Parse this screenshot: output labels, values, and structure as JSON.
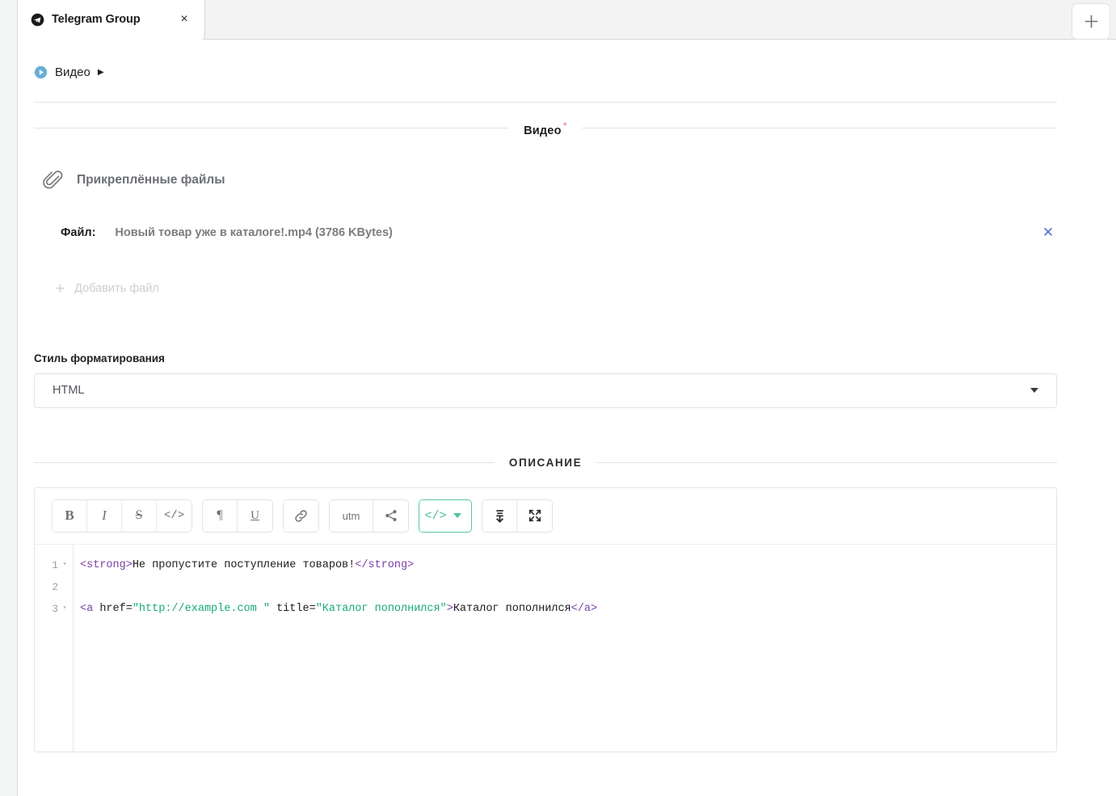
{
  "tab": {
    "title": "Telegram Group",
    "icon": "telegram-icon",
    "close_label": "×",
    "new_tab_label": "+"
  },
  "breadcrumb": {
    "label": "Видео",
    "arrow": "▶"
  },
  "sections": {
    "video": {
      "caption": "Видео",
      "required_mark": "*"
    },
    "description": {
      "caption": "ОПИСАНИЕ"
    }
  },
  "attachments": {
    "title": "Прикреплённые файлы",
    "file_label": "Файл:",
    "file_name": "Новый товар уже в каталоге!.mp4 (3786 KBytes)",
    "remove_label": "✕",
    "add_plus": "+",
    "add_label": "Добавить файл"
  },
  "format_field": {
    "label": "Стиль форматирования",
    "value": "HTML",
    "options": [
      "HTML"
    ]
  },
  "toolbar": {
    "bold": "B",
    "italic": "I",
    "strike": "S",
    "code": "</>",
    "paragraph": "¶",
    "underline": "U",
    "link_icon": "link-icon",
    "utm": "utm",
    "share_icon": "share-icon",
    "source_code": "</>",
    "insert_icon": "insert-variable-icon",
    "fullscreen_icon": "fullscreen-icon"
  },
  "editor": {
    "gutter": [
      {
        "num": "1",
        "fold": "▾"
      },
      {
        "num": "2",
        "fold": ""
      },
      {
        "num": "3",
        "fold": "▾"
      }
    ],
    "lines": [
      [
        {
          "t": "tag",
          "v": "<strong>"
        },
        {
          "t": "txt",
          "v": "Не пропустите поступление товаров!"
        },
        {
          "t": "tag",
          "v": "</strong>"
        }
      ],
      [],
      [
        {
          "t": "tag",
          "v": "<a "
        },
        {
          "t": "txt",
          "v": "href="
        },
        {
          "t": "str",
          "v": "\"http://example.com \""
        },
        {
          "t": "txt",
          "v": " title="
        },
        {
          "t": "str",
          "v": "\"Каталог пополнился\""
        },
        {
          "t": "tag",
          "v": ">"
        },
        {
          "t": "txt",
          "v": "Каталог пополнился"
        },
        {
          "t": "tag",
          "v": "</a>"
        }
      ]
    ]
  },
  "colors": {
    "accent_green": "#44bf9c",
    "required_red": "#e8737f",
    "link_blue": "#5d6ad0",
    "tag_purple": "#7b3fa8",
    "string_green": "#19a974",
    "telegram_blue": "#68aed4"
  }
}
